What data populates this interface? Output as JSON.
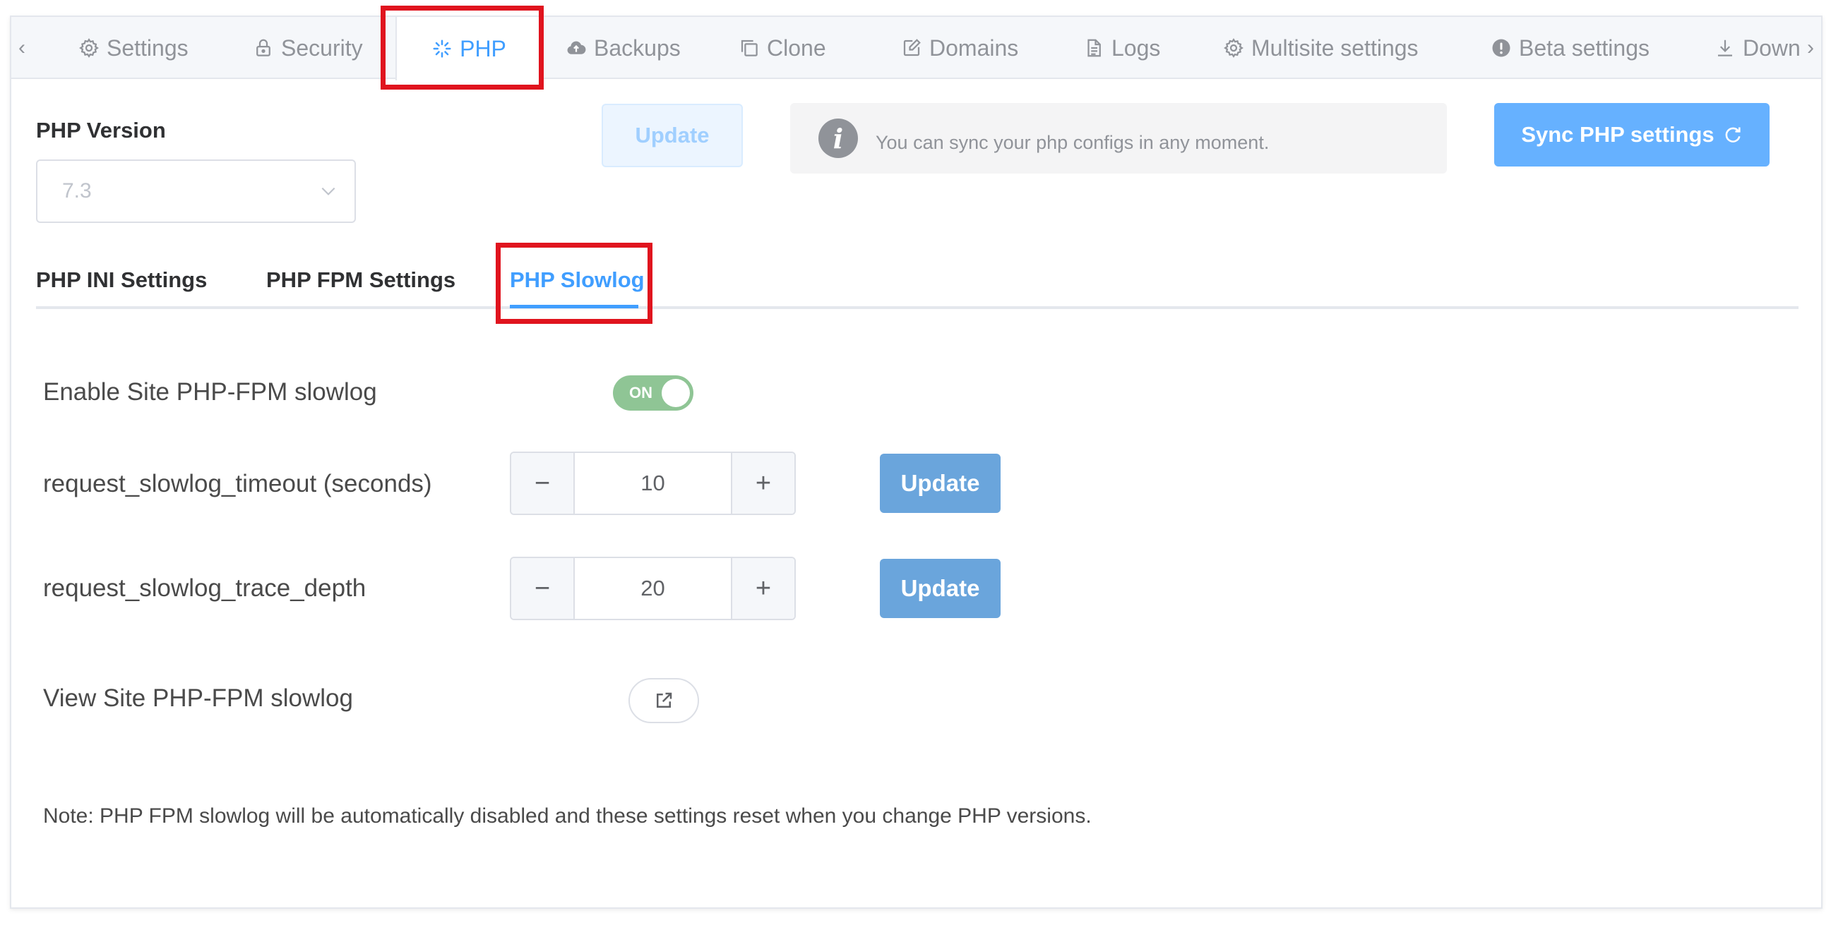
{
  "tabs": [
    {
      "label": "Settings",
      "icon": "gear-icon"
    },
    {
      "label": "Security",
      "icon": "lock-icon"
    },
    {
      "label": "PHP",
      "icon": "spinner-icon",
      "active": true
    },
    {
      "label": "Backups",
      "icon": "cloud-upload-icon"
    },
    {
      "label": "Clone",
      "icon": "copy-icon"
    },
    {
      "label": "Domains",
      "icon": "edit-icon"
    },
    {
      "label": "Logs",
      "icon": "document-icon"
    },
    {
      "label": "Multisite settings",
      "icon": "gear-icon"
    },
    {
      "label": "Beta settings",
      "icon": "warning-circle-icon"
    },
    {
      "label": "Down",
      "icon": "download-icon"
    }
  ],
  "php_version": {
    "label": "PHP Version",
    "value": "7.3"
  },
  "update_label": "Update",
  "info": {
    "icon": "info-icon",
    "glyph": "i",
    "text": "You can sync your php configs in any moment."
  },
  "sync_button": {
    "label": "Sync PHP settings",
    "icon": "refresh-icon"
  },
  "subtabs": [
    {
      "label": "PHP INI Settings"
    },
    {
      "label": "PHP FPM Settings"
    },
    {
      "label": "PHP Slowlog",
      "active": true
    }
  ],
  "slowlog": {
    "enable_label": "Enable Site PHP-FPM slowlog",
    "enable_state": "ON",
    "timeout_label": "request_slowlog_timeout (seconds)",
    "timeout_value": "10",
    "trace_label": "request_slowlog_trace_depth",
    "trace_value": "20",
    "update_label": "Update",
    "view_label": "View Site PHP-FPM slowlog",
    "stepper_minus": "−",
    "stepper_plus": "+"
  },
  "note": "Note: PHP FPM slowlog will be automatically disabled and these settings reset when you change PHP versions.",
  "colors": {
    "accent": "#409eff",
    "highlight": "#e0141e",
    "switch_on": "#8fc595",
    "update_button": "#6aa5dc"
  }
}
